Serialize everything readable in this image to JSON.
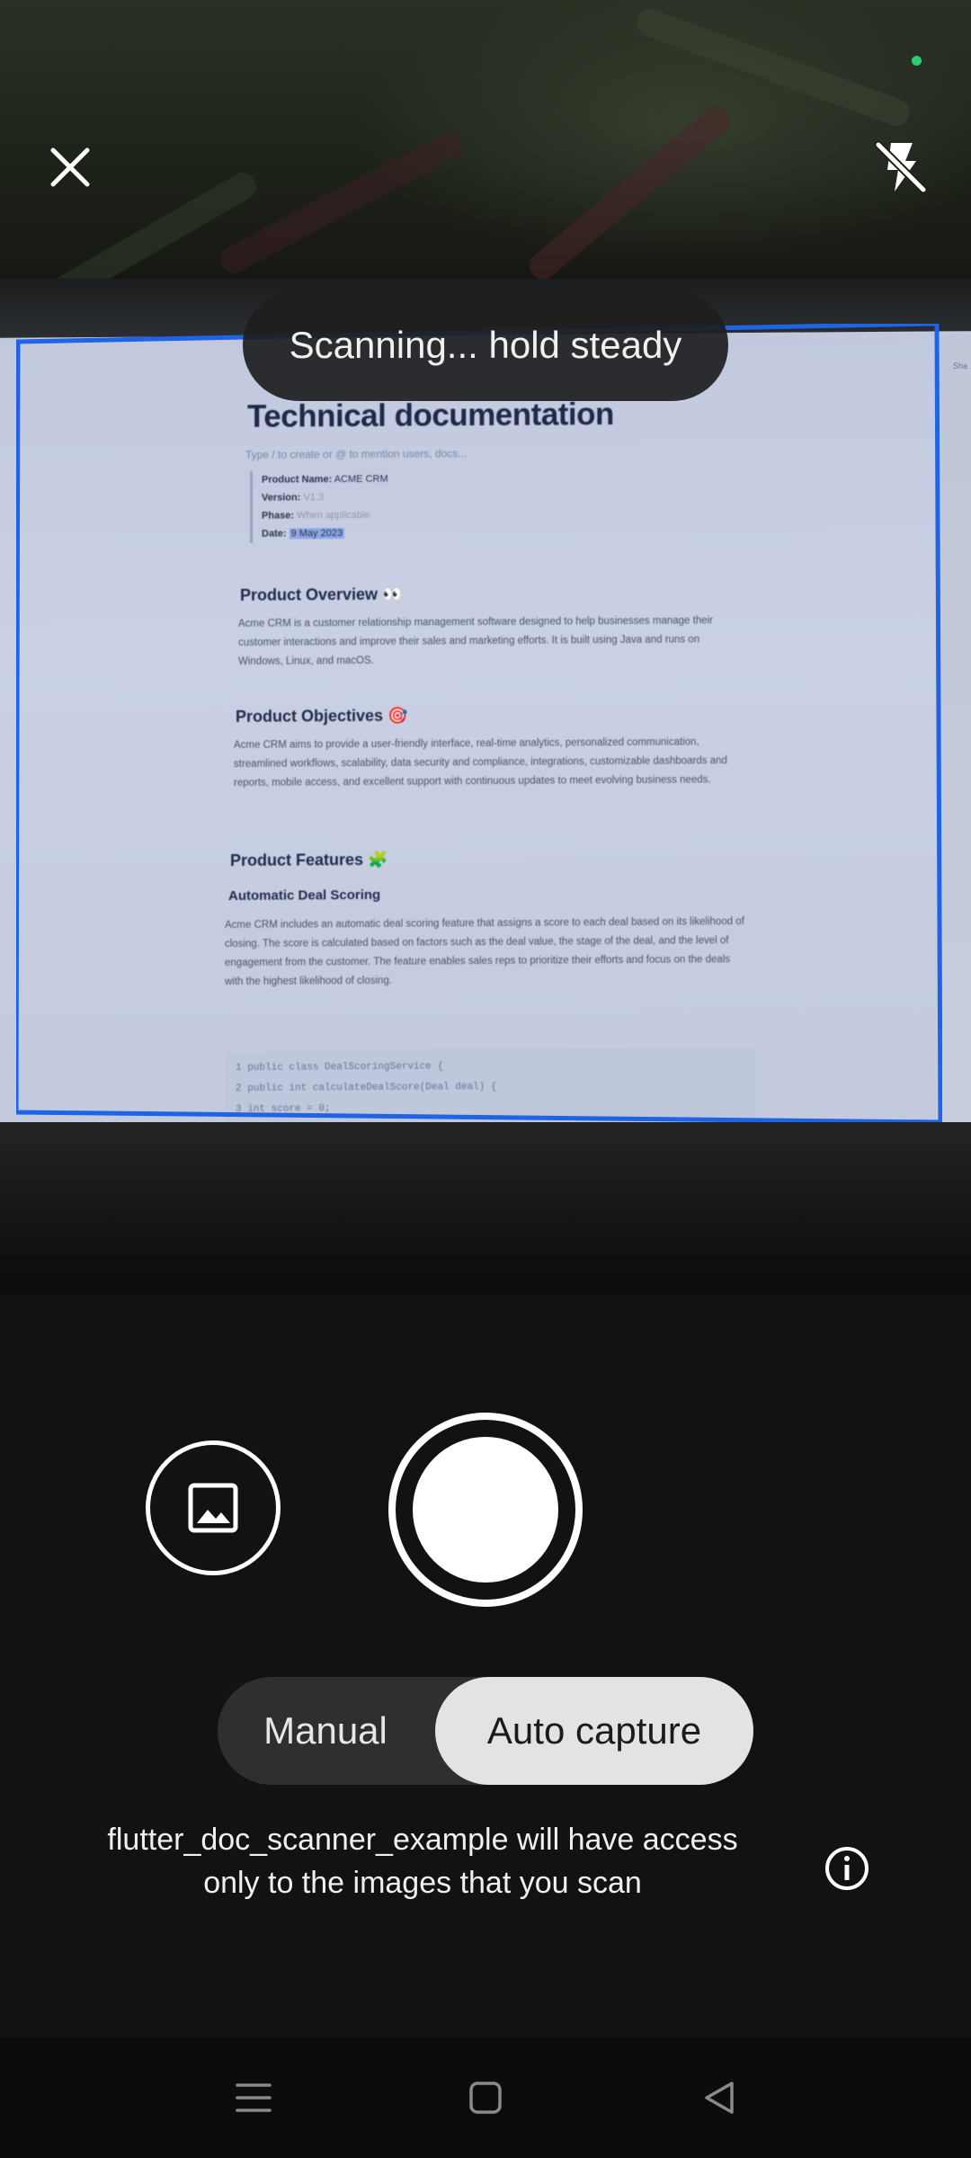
{
  "colors": {
    "scan_frame": "#1f63e6",
    "status_dot": "#2ecc71",
    "toggle_selected_bg": "#e3e3e3",
    "toggle_bg": "#2f2f31"
  },
  "top_bar": {
    "close_icon": "close-icon",
    "flash_icon": "flash-off-icon"
  },
  "toast": {
    "text": "Scanning... hold steady"
  },
  "document": {
    "title": "Technical documentation",
    "hint": "Type / to create or @ to mention users, docs...",
    "meta": [
      {
        "label": "Product Name:",
        "value": "ACME CRM"
      },
      {
        "label": "Version:",
        "value": "V1.3"
      },
      {
        "label": "Phase:",
        "value": "When applicable"
      },
      {
        "label": "Date:",
        "value": "9 May 2023"
      }
    ],
    "sections": [
      {
        "heading": "Product Overview 👀",
        "body": "Acme CRM is a customer relationship management software designed to help businesses manage their customer interactions and improve their sales and marketing efforts. It is built using Java and runs on Windows, Linux, and macOS."
      },
      {
        "heading": "Product Objectives 🎯",
        "body": "Acme CRM aims to provide a user-friendly interface, real-time analytics, personalized communication, streamlined workflows, scalability, data security and compliance, integrations, customizable dashboards and reports, mobile access, and excellent support with continuous updates to meet evolving business needs."
      },
      {
        "heading": "Product Features 🧩",
        "subheading": "Automatic Deal Scoring",
        "body": "Acme CRM includes an automatic deal scoring feature that assigns a score to each deal based on its likelihood of closing. The score is calculated based on factors such as the deal value, the stage of the deal, and the level of engagement from the customer. The feature enables sales reps to prioritize their efforts and focus on the deals with the highest likelihood of closing."
      }
    ],
    "code_lines": [
      "1   public class DealScoringService {",
      "2     public int calculateDealScore(Deal deal) {",
      "3       int score = 0;"
    ],
    "edge_text": "Sha"
  },
  "controls": {
    "gallery_icon": "image-icon",
    "modes": {
      "manual": "Manual",
      "auto": "Auto capture"
    },
    "selected_mode": "Auto capture"
  },
  "access_note": {
    "line1": "flutter_doc_scanner_example will have access",
    "line2": "only to the images that you scan"
  },
  "info_icon": "info-icon",
  "navbar": {
    "menu_icon": "menu-icon",
    "home_icon": "home-square-icon",
    "back_icon": "back-triangle-icon"
  }
}
